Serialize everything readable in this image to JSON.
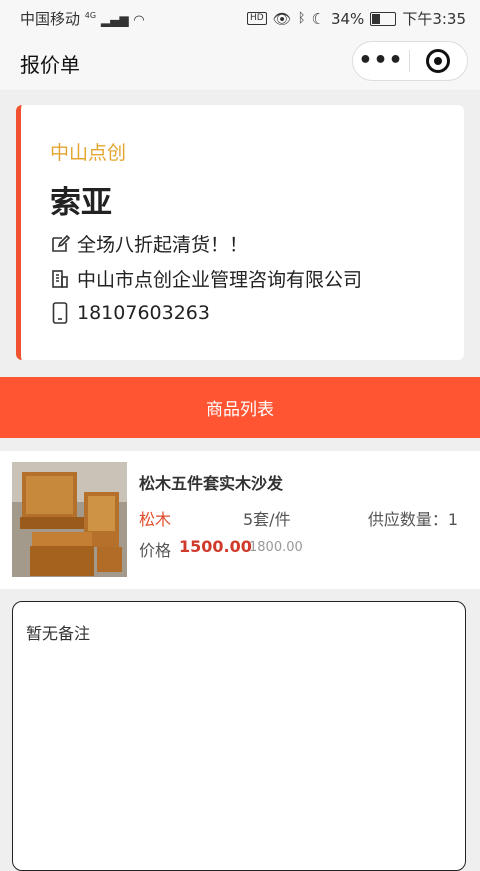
{
  "status_bar": {
    "carrier": "中国移动",
    "network": "4G",
    "battery": "34%",
    "time": "下午3:35"
  },
  "nav": {
    "title": "报价单",
    "more_label": "•••"
  },
  "card": {
    "company_short": "中山点创",
    "contact_name": "索亚",
    "slogan": "全场八折起清货！！",
    "company_full": "中山市点创企业管理咨询有限公司",
    "phone": "18107603263",
    "accent_color": "#f0522f"
  },
  "section": {
    "title": "商品列表",
    "color": "#ff5533"
  },
  "products": [
    {
      "name": "松木五件套实木沙发",
      "material": "松木",
      "spec": "5套/件",
      "supply": "供应数量：1",
      "price_label": "价格",
      "price": "1500.00",
      "original_price": "1800.00"
    }
  ],
  "remark": {
    "text": "暂无备注"
  }
}
